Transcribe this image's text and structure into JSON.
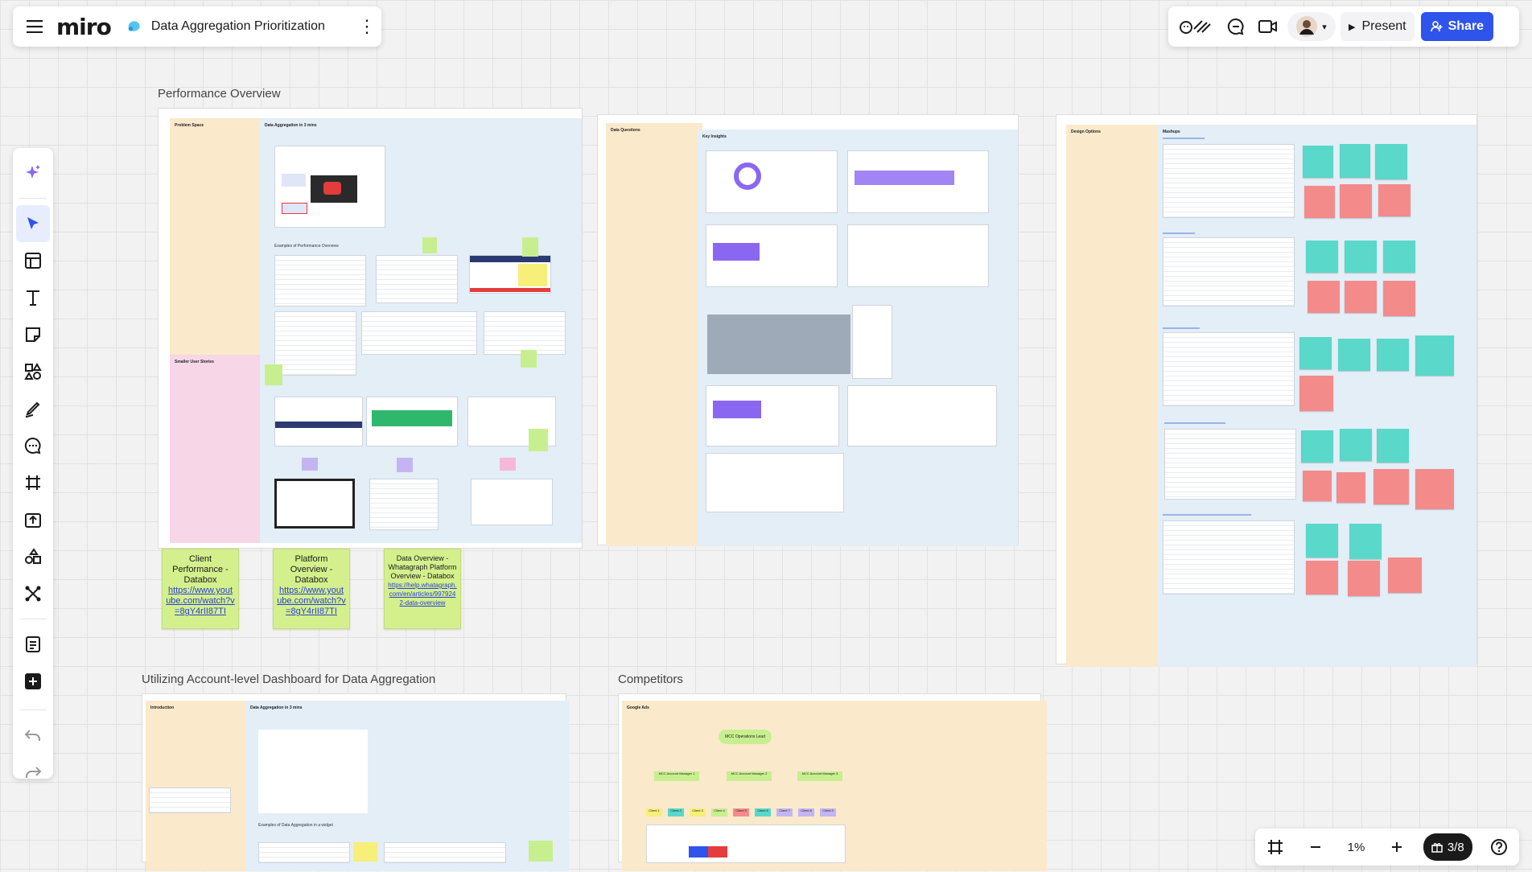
{
  "app": {
    "logo": "miro",
    "board_title": "Data Aggregation Prioritization"
  },
  "header": {
    "menu_icon": "hamburger-menu-icon",
    "more_icon": "more-vertical-icon",
    "present_label": "Present",
    "share_label": "Share"
  },
  "toolbar": {
    "tools": [
      "ai-sparkle",
      "select",
      "templates",
      "text",
      "sticky-note",
      "shapes",
      "pen",
      "comment",
      "frame",
      "upload",
      "more-apps",
      "integrations",
      "notes",
      "add"
    ],
    "undo": "undo-icon",
    "redo": "redo-icon"
  },
  "bottom": {
    "zoom": "1%",
    "page": "3/8"
  },
  "colors": {
    "accent": "#2f54eb",
    "sticky_green": "#d4f08c",
    "tan": "#fbe9cc",
    "light_blue": "#e3eef7",
    "pink": "#f7d6e8"
  },
  "frames": {
    "performance": {
      "title": "Performance Overview",
      "col1_title": "Problem Space",
      "col2_title": "Data Aggregation in 3 mins",
      "examples_title": "Examples of Performance Overview",
      "stories_title": "Smaller User Stories"
    },
    "mid": {
      "col1_title": "Data Questions",
      "col2_title": "Key Insights"
    },
    "design": {
      "col1_title": "Design Options",
      "col2_title": "Mashups"
    },
    "account": {
      "title": "Utilizing Account-level Dashboard for Data Aggregation",
      "col1_title": "Introduction",
      "col2_title": "Data Aggregation in 3 mins",
      "examples_title": "Examples of Data Aggregation in a widget"
    },
    "competitors": {
      "title": "Competitors",
      "col_title": "Google Ads",
      "root_node": "MCC Operations Lead",
      "managers": [
        "MCC Account Manager 1",
        "MCC Account Manager 2",
        "MCC Account Manager 3"
      ],
      "clients": [
        "Client 1",
        "Client 2",
        "Client 3",
        "Client 4",
        "Client 5",
        "Client 6",
        "Client 7",
        "Client 8",
        "Client 9"
      ]
    }
  },
  "stickies": [
    {
      "label": "Client Performance - Databox",
      "link": "https://www.youtube.com/watch?v=8gY4rII87TI"
    },
    {
      "label": "Platform Overview - Databox",
      "link": "https://www.youtube.com/watch?v=8gY4rII87TI"
    },
    {
      "label": "Data Overview - Whatagraph Platform Overview - Databox",
      "link": "https://help.whatagraph.com/en/articles/9979242-data-overview"
    }
  ]
}
